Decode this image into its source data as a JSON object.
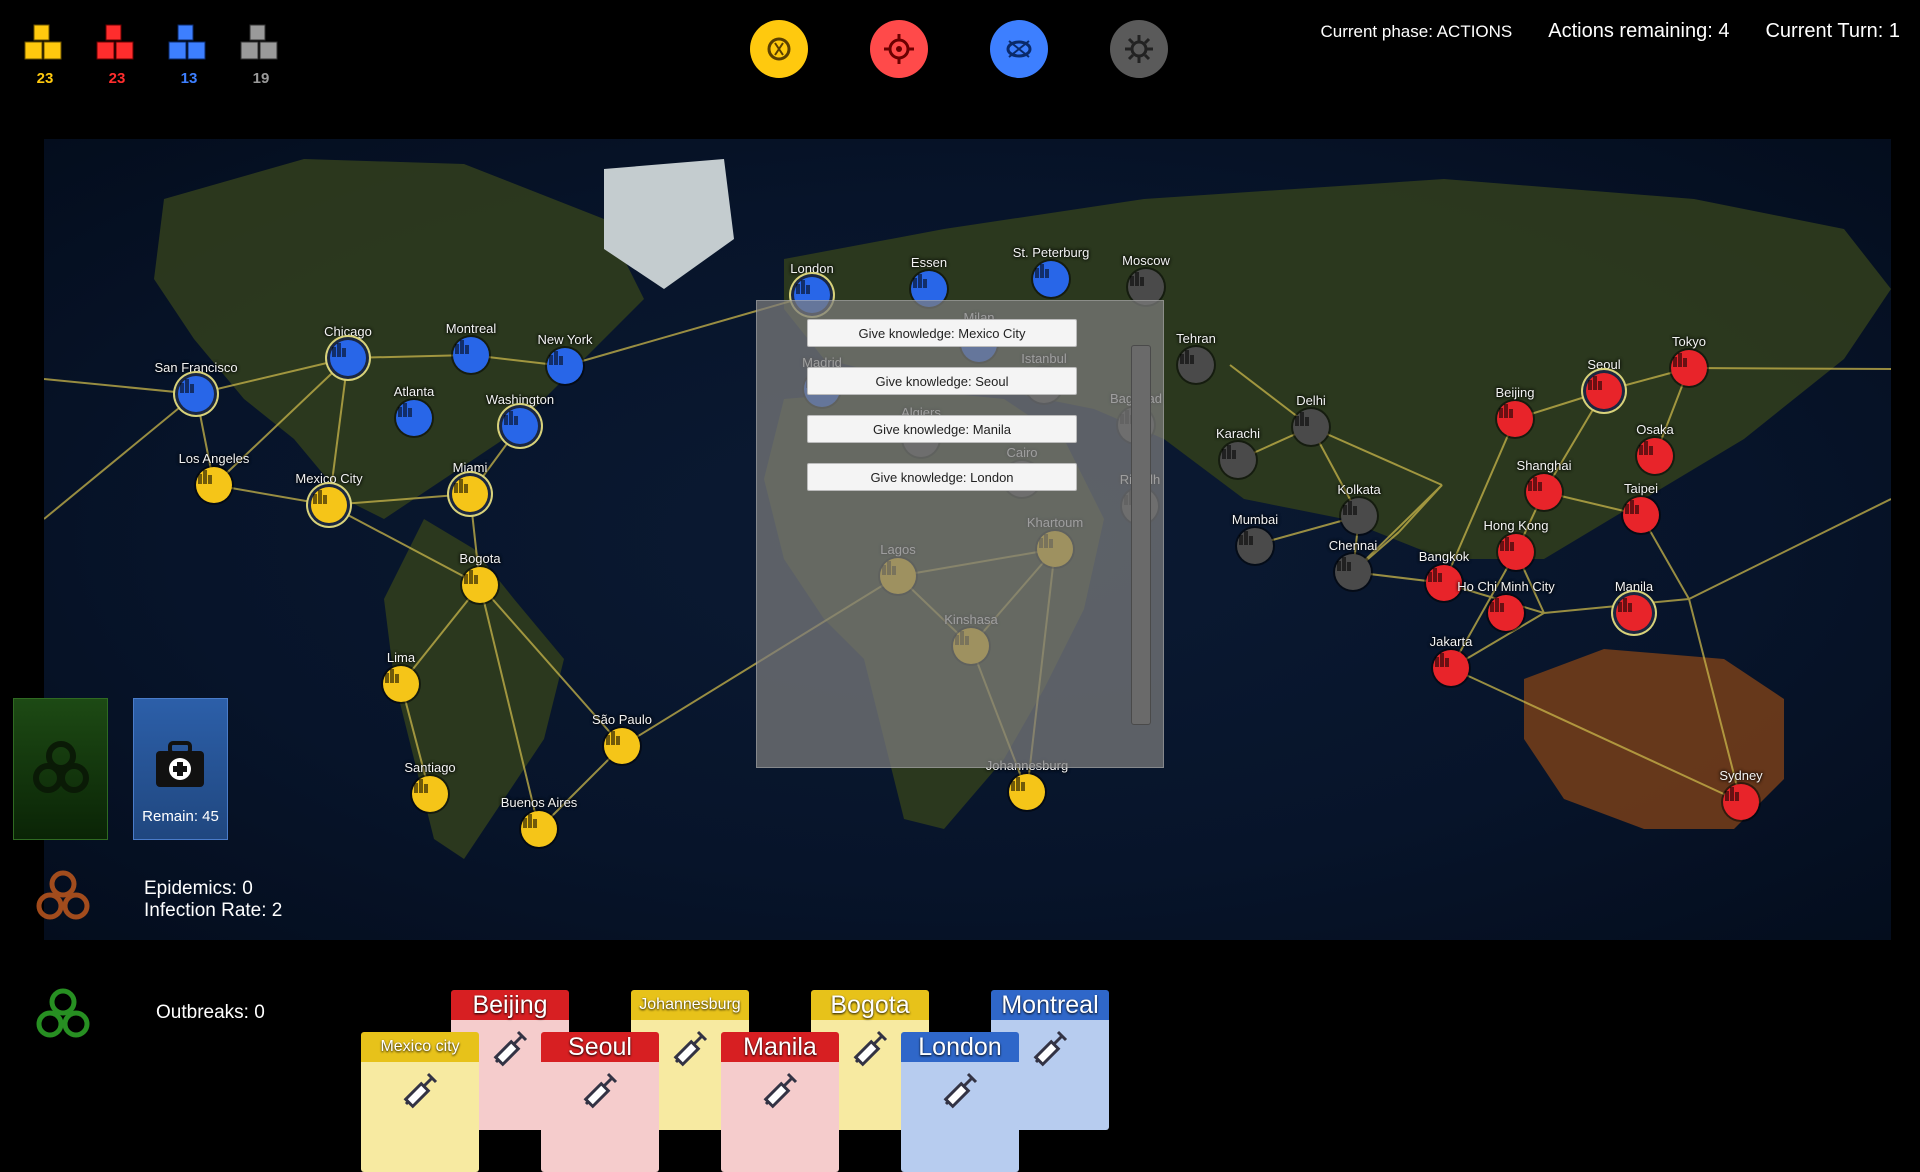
{
  "supply": [
    {
      "color": "#ffc90e",
      "count": "23",
      "icon": "yellow-cubes-icon"
    },
    {
      "color": "#ff2d2d",
      "count": "23",
      "icon": "red-cubes-icon"
    },
    {
      "color": "#3d7fff",
      "count": "13",
      "icon": "blue-cubes-icon"
    },
    {
      "color": "#9a9a9a",
      "count": "19",
      "icon": "black-cubes-icon"
    }
  ],
  "cures": [
    {
      "color": "#ffc90e",
      "icon": "yellow-virus-icon"
    },
    {
      "color": "#ff4a4a",
      "icon": "red-virus-icon"
    },
    {
      "color": "#3d7fff",
      "icon": "blue-virus-icon"
    },
    {
      "color": "#5a5a5a",
      "icon": "black-virus-icon"
    }
  ],
  "status": {
    "phase": "Current phase: ACTIONS",
    "actions": "Actions remaining: 4",
    "turn": "Current Turn: 1"
  },
  "panel": {
    "buttons": [
      "Give knowledge: Mexico City",
      "Give knowledge: Seoul",
      "Give knowledge: Manila",
      "Give knowledge: London"
    ]
  },
  "cities": [
    {
      "name": "San Francisco",
      "color": "blue"
    },
    {
      "name": "Chicago",
      "color": "blue"
    },
    {
      "name": "Montreal",
      "color": "blue"
    },
    {
      "name": "New York",
      "color": "blue"
    },
    {
      "name": "Atlanta",
      "color": "blue"
    },
    {
      "name": "Washington",
      "color": "blue"
    },
    {
      "name": "Los Angeles",
      "color": "yellow"
    },
    {
      "name": "Mexico City",
      "color": "yellow"
    },
    {
      "name": "Miami",
      "color": "yellow"
    },
    {
      "name": "Bogota",
      "color": "yellow"
    },
    {
      "name": "Lima",
      "color": "yellow"
    },
    {
      "name": "Santiago",
      "color": "yellow"
    },
    {
      "name": "Buenos Aires",
      "color": "yellow"
    },
    {
      "name": "São Paulo",
      "color": "yellow"
    },
    {
      "name": "London",
      "color": "blue"
    },
    {
      "name": "Essen",
      "color": "blue"
    },
    {
      "name": "St. Peterburg",
      "color": "blue"
    },
    {
      "name": "Moscow",
      "color": "black"
    },
    {
      "name": "Madrid",
      "color": "blue"
    },
    {
      "name": "Milan",
      "color": "blue"
    },
    {
      "name": "Istanbul",
      "color": "black"
    },
    {
      "name": "Algiers",
      "color": "black"
    },
    {
      "name": "Cairo",
      "color": "black"
    },
    {
      "name": "Baghdad",
      "color": "black"
    },
    {
      "name": "Riyadh",
      "color": "black"
    },
    {
      "name": "Lagos",
      "color": "yellow"
    },
    {
      "name": "Khartoum",
      "color": "yellow"
    },
    {
      "name": "Kinshasa",
      "color": "yellow"
    },
    {
      "name": "Johannesburg",
      "color": "yellow"
    },
    {
      "name": "Tehran",
      "color": "black"
    },
    {
      "name": "Karachi",
      "color": "black"
    },
    {
      "name": "Delhi",
      "color": "black"
    },
    {
      "name": "Mumbai",
      "color": "black"
    },
    {
      "name": "Kolkata",
      "color": "black"
    },
    {
      "name": "Chennai",
      "color": "black"
    },
    {
      "name": "Beijing",
      "color": "red"
    },
    {
      "name": "Seoul",
      "color": "red"
    },
    {
      "name": "Tokyo",
      "color": "red"
    },
    {
      "name": "Shanghai",
      "color": "red"
    },
    {
      "name": "Osaka",
      "color": "red"
    },
    {
      "name": "Hong Kong",
      "color": "red"
    },
    {
      "name": "Taipei",
      "color": "red"
    },
    {
      "name": "Bangkok",
      "color": "red"
    },
    {
      "name": "Ho Chi Minh City",
      "color": "red"
    },
    {
      "name": "Manila",
      "color": "red"
    },
    {
      "name": "Jakarta",
      "color": "red"
    },
    {
      "name": "Sydney",
      "color": "red"
    }
  ],
  "player_deck": {
    "remain": "Remain: 45",
    "icon": "medkit-icon"
  },
  "infection_deck": {
    "icon": "biohazard-icon"
  },
  "counters": {
    "epidemics": "Epidemics: 0",
    "infection_rate": "Infection Rate: 2",
    "outbreaks": "Outbreaks: 0"
  },
  "hand": [
    {
      "name": "Beijing",
      "color": "red"
    },
    {
      "name": "Johannesburg",
      "color": "yellow"
    },
    {
      "name": "Bogota",
      "color": "yellow"
    },
    {
      "name": "Montreal",
      "color": "blue"
    },
    {
      "name": "Mexico city",
      "color": "yellow"
    },
    {
      "name": "Seoul",
      "color": "red"
    },
    {
      "name": "Manila",
      "color": "red"
    },
    {
      "name": "London",
      "color": "blue"
    }
  ],
  "colors": {
    "yellow": "#f5c518",
    "red": "#e8242a",
    "blue": "#2866e8",
    "black": "#4a4a4a"
  }
}
